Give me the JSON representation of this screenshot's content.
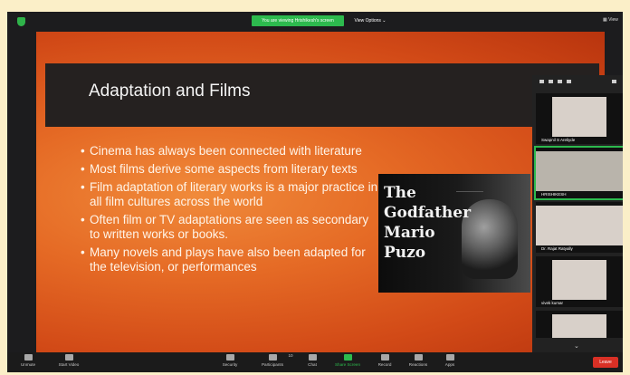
{
  "top_bar": {
    "viewing": "You are viewing Hrishikesh's screen",
    "view_options": "View Options",
    "view": "View"
  },
  "slide": {
    "title": "Adaptation and Films",
    "bullets": [
      "Cinema has always been connected with literature",
      "Most films derive some aspects from literary texts",
      "Film adaptation of literary works is a major practice in all film cultures across the world",
      "Often film or TV adaptations are seen as secondary to written works or books.",
      "Many novels and plays have also been adapted for the television, or performances"
    ]
  },
  "poster": {
    "line1": "The",
    "line2": "Godfather",
    "line3": "Mario",
    "line4": "Puzo"
  },
  "participants": [
    {
      "name": "Swapnil S Areliyde"
    },
    {
      "name": "HRISHIKESH"
    },
    {
      "name": "Dr. Rajat Ratyally"
    },
    {
      "name": "vivek kumar"
    },
    {
      "name": ""
    }
  ],
  "toolbar": {
    "unmute": "Unmute",
    "start_video": "Start Video",
    "security": "Security",
    "participants": "Participants",
    "participants_count": "10",
    "chat": "Chat",
    "share_screen": "Share Screen",
    "record": "Record",
    "reactions": "Reactions",
    "apps": "Apps",
    "leave": "Leave"
  },
  "colors": {
    "accent_green": "#2dba4e",
    "leave_red": "#d93025"
  }
}
